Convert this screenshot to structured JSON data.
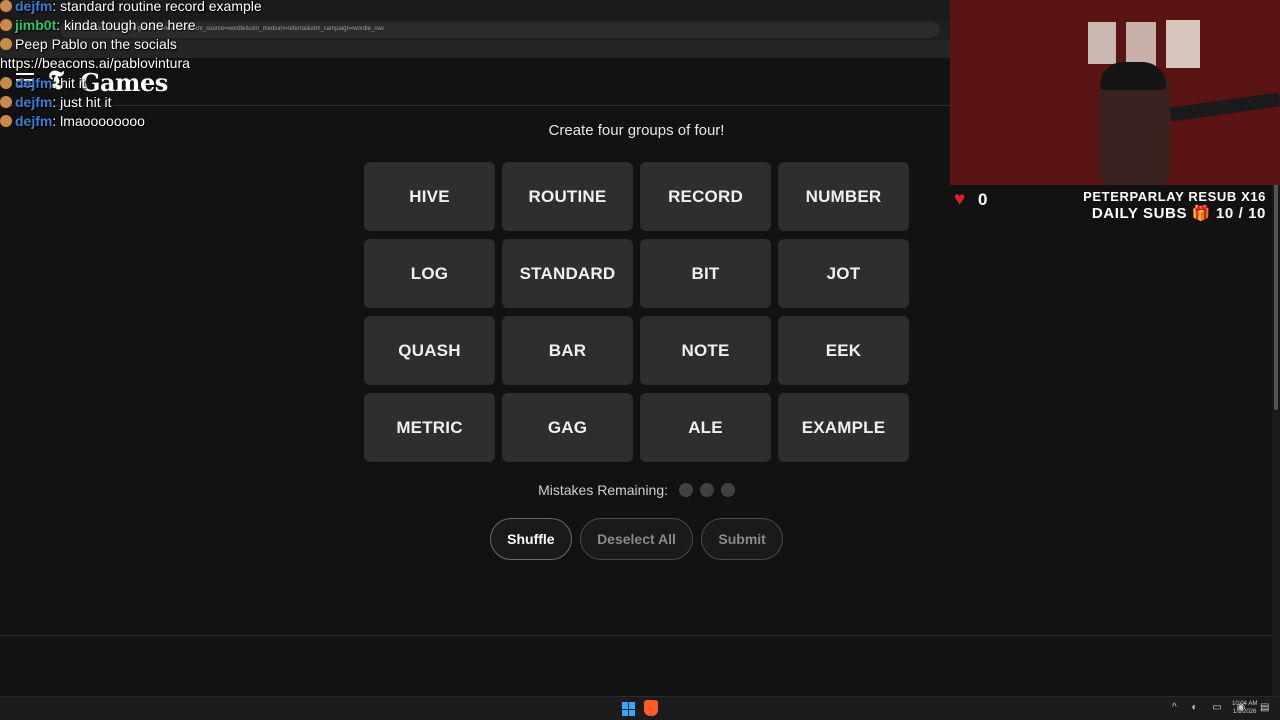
{
  "browser": {
    "url": "https://www.nytimes.com/games/connections?utm_source=wordle&utm_medium=referral&utm_campaign=wordle_nav"
  },
  "header": {
    "logo_t": "𝕿",
    "logo_text": "Games"
  },
  "game": {
    "instruction": "Create four groups of four!",
    "words": [
      "HIVE",
      "ROUTINE",
      "RECORD",
      "NUMBER",
      "LOG",
      "STANDARD",
      "BIT",
      "JOT",
      "QUASH",
      "BAR",
      "NOTE",
      "EEK",
      "METRIC",
      "GAG",
      "ALE",
      "EXAMPLE"
    ],
    "mistakes_label": "Mistakes Remaining:",
    "mistakes_remaining": 3,
    "buttons": {
      "shuffle": "Shuffle",
      "deselect": "Deselect All",
      "submit": "Submit"
    }
  },
  "chat": [
    {
      "user": "dejfm",
      "sep": ": ",
      "text": "standard routine record example"
    },
    {
      "user": "jimb0t",
      "sep": ": ",
      "text": "kinda tough one here"
    },
    {
      "user": "",
      "sep": "",
      "text": "Peep Pablo on the socials"
    },
    {
      "user": "",
      "sep": "",
      "text": "https://beacons.ai/pablovintura"
    },
    {
      "user": "dejfm",
      "sep": ": ",
      "text": "hit it"
    },
    {
      "user": "dejfm",
      "sep": ": ",
      "text": "just hit it"
    },
    {
      "user": "dejfm",
      "sep": ": ",
      "text": "lmaoooooooo"
    }
  ],
  "stream": {
    "hearts": "0",
    "resub": "PETERPARLAY RESUB X16",
    "daily_subs_label": "DAILY SUBS",
    "daily_subs_count": "10 / 10"
  },
  "taskbar": {
    "time": "10:04 AM",
    "date": "1/2/2026"
  }
}
